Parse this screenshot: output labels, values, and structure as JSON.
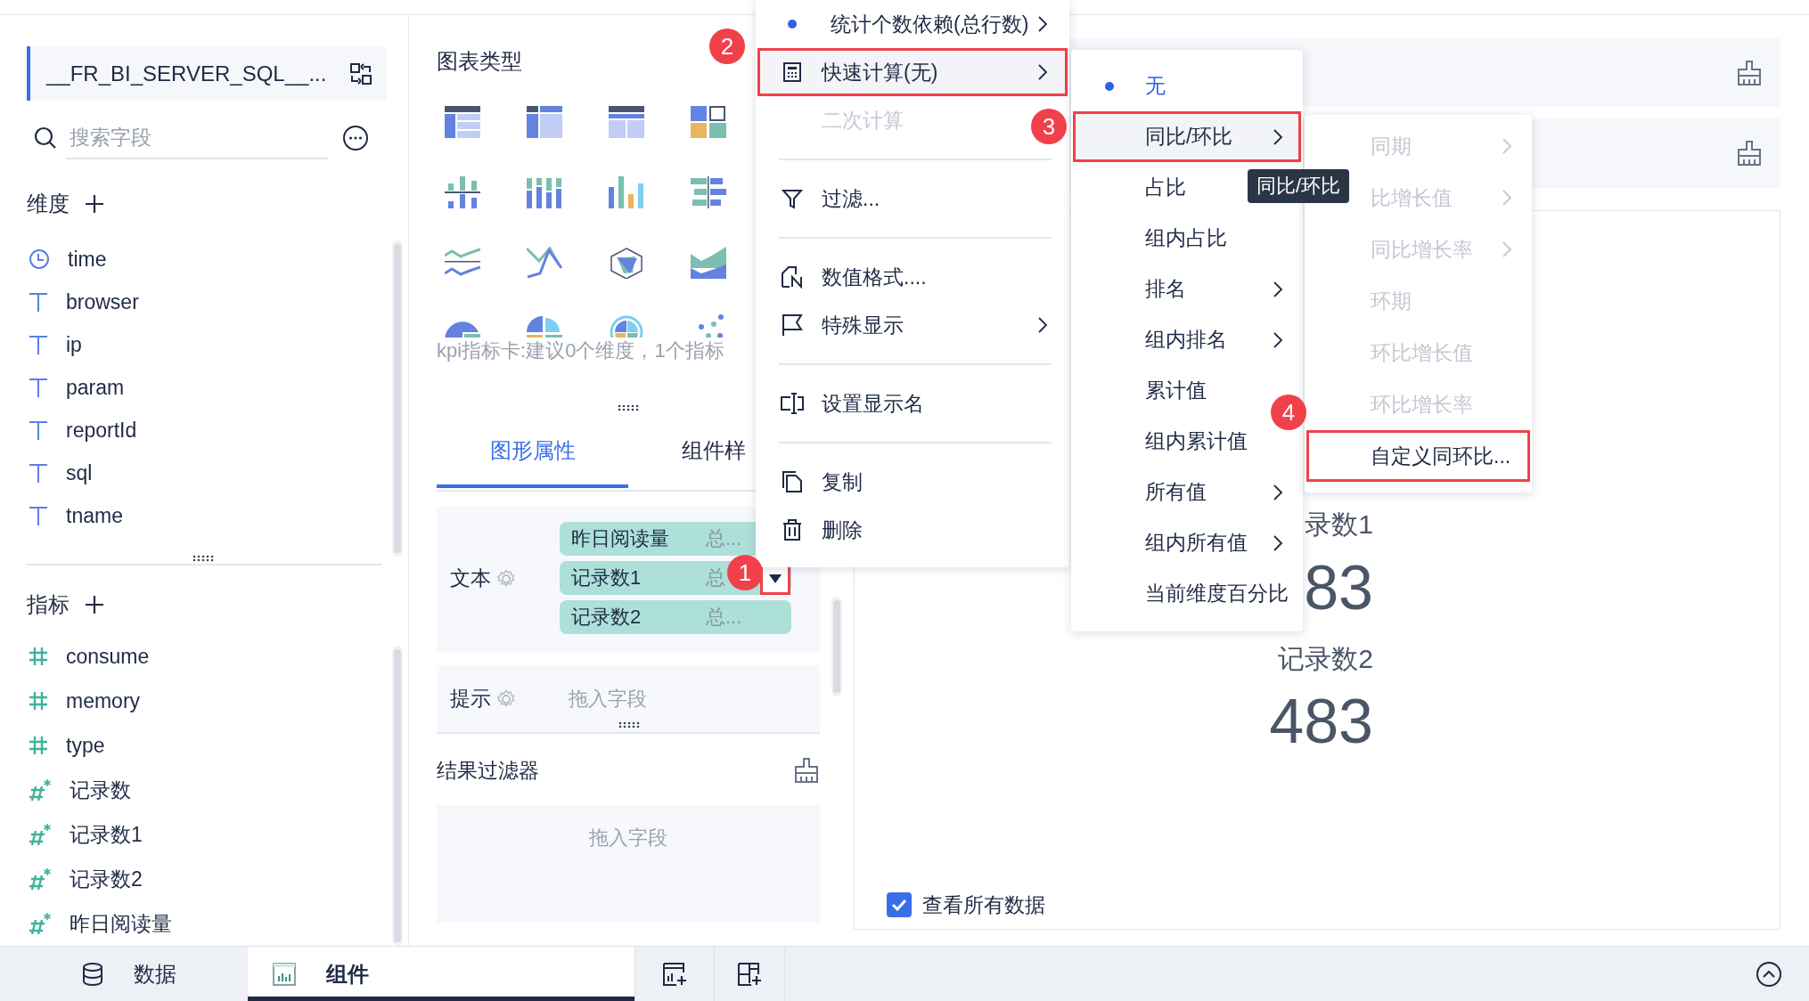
{
  "data_source": {
    "name": "__FR_BI_SERVER_SQL__..."
  },
  "search": {
    "placeholder": "搜索字段"
  },
  "dimensions": {
    "title": "维度",
    "fields": [
      {
        "name": "time",
        "kind": "date"
      },
      {
        "name": "browser",
        "kind": "text"
      },
      {
        "name": "ip",
        "kind": "text"
      },
      {
        "name": "param",
        "kind": "text"
      },
      {
        "name": "reportId",
        "kind": "text"
      },
      {
        "name": "sql",
        "kind": "text"
      },
      {
        "name": "tname",
        "kind": "text"
      }
    ]
  },
  "measures": {
    "title": "指标",
    "fields": [
      {
        "name": "consume",
        "kind": "number"
      },
      {
        "name": "memory",
        "kind": "number"
      },
      {
        "name": "type",
        "kind": "number"
      },
      {
        "name": "记录数",
        "kind": "calculated"
      },
      {
        "name": "记录数1",
        "kind": "calculated"
      },
      {
        "name": "记录数2",
        "kind": "calculated"
      },
      {
        "name": "昨日阅读量",
        "kind": "calculated"
      }
    ]
  },
  "chart_types": {
    "title": "图表类型",
    "hint": "kpi指标卡:建议0个维度，1个指标"
  },
  "property_tabs": [
    {
      "label": "图形属性",
      "selected": true
    },
    {
      "label": "组件样",
      "selected": false
    }
  ],
  "text_well": {
    "label": "文本",
    "fields": [
      {
        "name": "昨日阅读量",
        "summary": "总...",
        "annotated": false
      },
      {
        "name": "记录数1",
        "summary": "总",
        "annotated": true
      },
      {
        "name": "记录数2",
        "summary": "总...",
        "annotated": false
      }
    ]
  },
  "tooltip_well": {
    "label": "提示",
    "placeholder": "拖入字段"
  },
  "result_filter": {
    "title": "结果过滤器",
    "placeholder": "拖入字段"
  },
  "preview": {
    "kpis": [
      {
        "label": "录数1",
        "value": "83"
      },
      {
        "label": "记录数2",
        "value": "483"
      }
    ],
    "show_all_data": {
      "label": "查看所有数据",
      "checked": true
    }
  },
  "bottom_tabs": [
    {
      "label": "数据",
      "selected": false
    },
    {
      "label": "组件",
      "selected": true
    }
  ],
  "field_menu": {
    "items": [
      {
        "label": "统计个数依赖(总行数)",
        "selected": true,
        "disabled": false,
        "submenu": true,
        "expanded": false,
        "annotated": false,
        "divider_before": false
      },
      {
        "label": "快速计算(无)",
        "selected": false,
        "disabled": false,
        "submenu": true,
        "expanded": true,
        "annotated": true,
        "divider_before": false
      },
      {
        "label": "二次计算",
        "selected": false,
        "disabled": true,
        "submenu": false,
        "expanded": false,
        "annotated": false,
        "divider_before": false
      },
      {
        "label": "过滤...",
        "selected": false,
        "disabled": false,
        "submenu": false,
        "expanded": false,
        "annotated": false,
        "divider_before": true
      },
      {
        "label": "数值格式....",
        "selected": false,
        "disabled": false,
        "submenu": false,
        "expanded": false,
        "annotated": false,
        "divider_before": true
      },
      {
        "label": "特殊显示",
        "selected": false,
        "disabled": false,
        "submenu": true,
        "expanded": false,
        "annotated": false,
        "divider_before": false
      },
      {
        "label": "设置显示名",
        "selected": false,
        "disabled": false,
        "submenu": false,
        "expanded": false,
        "annotated": false,
        "divider_before": true
      },
      {
        "label": "复制",
        "selected": false,
        "disabled": false,
        "submenu": false,
        "expanded": false,
        "annotated": false,
        "divider_before": true
      },
      {
        "label": "删除",
        "selected": false,
        "disabled": false,
        "submenu": false,
        "expanded": false,
        "annotated": false,
        "divider_before": false
      }
    ]
  },
  "quick_calc_menu": {
    "items": [
      {
        "label": "无",
        "selected": true,
        "submenu": false,
        "expanded": false,
        "annotated": false
      },
      {
        "label": "同比/环比",
        "selected": false,
        "submenu": true,
        "expanded": true,
        "annotated": true
      },
      {
        "label": "占比",
        "selected": false,
        "submenu": false,
        "expanded": false,
        "annotated": false
      },
      {
        "label": "组内占比",
        "selected": false,
        "submenu": false,
        "expanded": false,
        "annotated": false
      },
      {
        "label": "排名",
        "selected": false,
        "submenu": true,
        "expanded": false,
        "annotated": false
      },
      {
        "label": "组内排名",
        "selected": false,
        "submenu": true,
        "expanded": false,
        "annotated": false
      },
      {
        "label": "累计值",
        "selected": false,
        "submenu": false,
        "expanded": false,
        "annotated": false
      },
      {
        "label": "组内累计值",
        "selected": false,
        "submenu": false,
        "expanded": false,
        "annotated": false
      },
      {
        "label": "所有值",
        "selected": false,
        "submenu": true,
        "expanded": false,
        "annotated": false
      },
      {
        "label": "组内所有值",
        "selected": false,
        "submenu": true,
        "expanded": false,
        "annotated": false
      },
      {
        "label": "当前维度百分比",
        "selected": false,
        "submenu": false,
        "expanded": false,
        "annotated": false
      }
    ]
  },
  "period_menu": {
    "items": [
      {
        "label": "同期",
        "disabled": true,
        "submenu": true,
        "annotated": false
      },
      {
        "label": "比增长值",
        "disabled": true,
        "submenu": true,
        "annotated": false
      },
      {
        "label": "同比增长率",
        "disabled": true,
        "submenu": true,
        "annotated": false
      },
      {
        "label": "环期",
        "disabled": true,
        "submenu": false,
        "annotated": false
      },
      {
        "label": "环比增长值",
        "disabled": true,
        "submenu": false,
        "annotated": false
      },
      {
        "label": "环比增长率",
        "disabled": true,
        "submenu": false,
        "annotated": false
      },
      {
        "label": "自定义同环比...",
        "disabled": false,
        "submenu": false,
        "annotated": true
      }
    ]
  },
  "tooltip": {
    "text": "同比/环比"
  },
  "annotations": [
    {
      "number": "1"
    },
    {
      "number": "2"
    },
    {
      "number": "3"
    },
    {
      "number": "4"
    }
  ]
}
